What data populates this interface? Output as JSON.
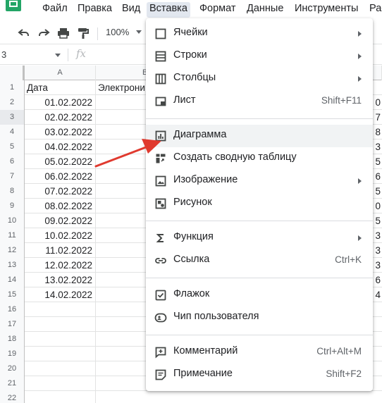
{
  "menubar": {
    "items": [
      "Файл",
      "Правка",
      "Вид",
      "Вставка",
      "Формат",
      "Данные",
      "Инструменты",
      "Рас"
    ]
  },
  "toolbar": {
    "zoom": "100%"
  },
  "formula_bar": {
    "name_box": "3",
    "fx": "fx"
  },
  "grid": {
    "col_a": "A",
    "col_b": "B",
    "rows": [
      {
        "n": "1",
        "a": "Дата",
        "b": "Электрони",
        "r": ""
      },
      {
        "n": "2",
        "a": "01.02.2022",
        "b": "",
        "r": "0"
      },
      {
        "n": "3",
        "a": "02.02.2022",
        "b": "",
        "r": "7"
      },
      {
        "n": "4",
        "a": "03.02.2022",
        "b": "",
        "r": "8"
      },
      {
        "n": "5",
        "a": "04.02.2022",
        "b": "",
        "r": "3"
      },
      {
        "n": "6",
        "a": "05.02.2022",
        "b": "",
        "r": "5"
      },
      {
        "n": "7",
        "a": "06.02.2022",
        "b": "",
        "r": "6"
      },
      {
        "n": "8",
        "a": "07.02.2022",
        "b": "",
        "r": "5"
      },
      {
        "n": "9",
        "a": "08.02.2022",
        "b": "",
        "r": "0"
      },
      {
        "n": "10",
        "a": "09.02.2022",
        "b": "",
        "r": "5"
      },
      {
        "n": "11",
        "a": "10.02.2022",
        "b": "",
        "r": "3"
      },
      {
        "n": "12",
        "a": "11.02.2022",
        "b": "",
        "r": "3"
      },
      {
        "n": "13",
        "a": "12.02.2022",
        "b": "",
        "r": "3"
      },
      {
        "n": "14",
        "a": "13.02.2022",
        "b": "",
        "r": "6"
      },
      {
        "n": "15",
        "a": "14.02.2022",
        "b": "",
        "r": "4"
      },
      {
        "n": "16",
        "a": "",
        "b": "",
        "r": ""
      },
      {
        "n": "17",
        "a": "",
        "b": "",
        "r": ""
      },
      {
        "n": "18",
        "a": "",
        "b": "",
        "r": ""
      },
      {
        "n": "19",
        "a": "",
        "b": "",
        "r": ""
      },
      {
        "n": "20",
        "a": "",
        "b": "",
        "r": ""
      },
      {
        "n": "21",
        "a": "",
        "b": "",
        "r": ""
      },
      {
        "n": "22",
        "a": "",
        "b": "",
        "r": ""
      }
    ]
  },
  "dropdown": {
    "items": [
      {
        "label": "Ячейки",
        "shortcut": "",
        "icon": "cell-icon"
      },
      {
        "label": "Строки",
        "shortcut": "",
        "icon": "rows-icon"
      },
      {
        "label": "Столбцы",
        "shortcut": "",
        "icon": "columns-icon"
      },
      {
        "label": "Лист",
        "shortcut": "Shift+F11",
        "icon": "sheet-icon"
      },
      {
        "label": "Диаграмма",
        "shortcut": "",
        "icon": "chart-icon"
      },
      {
        "label": "Создать сводную таблицу",
        "shortcut": "",
        "icon": "pivot-table-icon"
      },
      {
        "label": "Изображение",
        "shortcut": "",
        "icon": "image-icon"
      },
      {
        "label": "Рисунок",
        "shortcut": "",
        "icon": "drawing-icon"
      },
      {
        "label": "Функция",
        "shortcut": "",
        "icon": "sigma-icon"
      },
      {
        "label": "Ссылка",
        "shortcut": "Ctrl+K",
        "icon": "link-icon"
      },
      {
        "label": "Флажок",
        "shortcut": "",
        "icon": "checkbox-icon"
      },
      {
        "label": "Чип пользователя",
        "shortcut": "",
        "icon": "person-chip-icon"
      },
      {
        "label": "Комментарий",
        "shortcut": "Ctrl+Alt+M",
        "icon": "add-comment-icon"
      },
      {
        "label": "Примечание",
        "shortcut": "Shift+F2",
        "icon": "note-icon"
      }
    ]
  },
  "colors": {
    "accent_arrow": "#e03a2f",
    "sheets_green": "#23a566",
    "menu_active": "#e2e7ef",
    "hover": "#f1f3f4"
  }
}
